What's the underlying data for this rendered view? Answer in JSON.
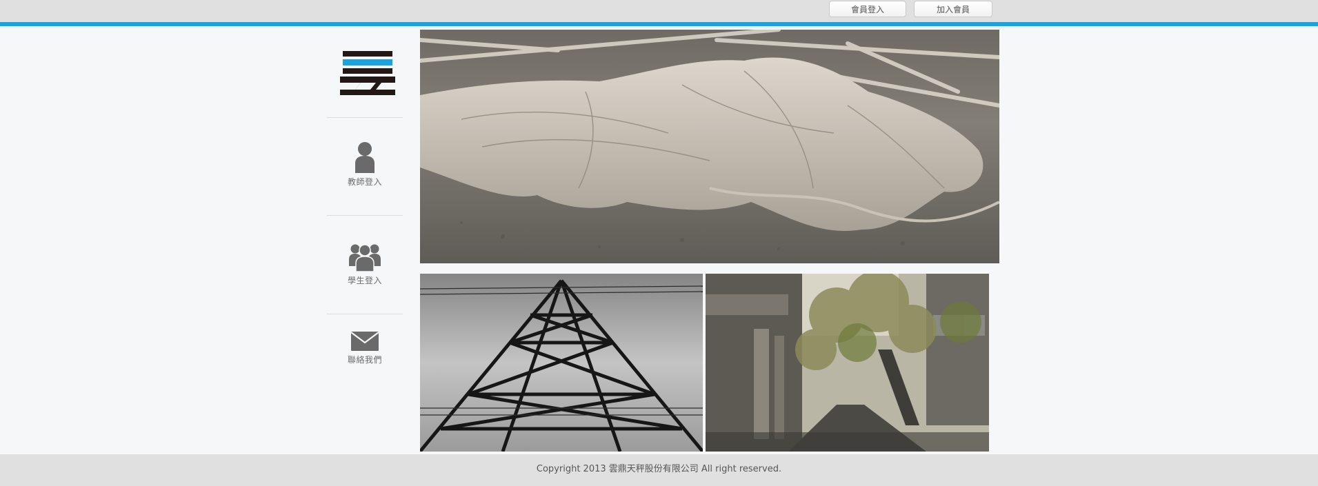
{
  "header": {
    "member_login_label": "會員登入",
    "join_member_label": "加入會員"
  },
  "colors": {
    "accent": "#1aa3df",
    "bar_gray": "#e1e0e0",
    "icon_gray": "#6a6a6a",
    "logo_dark": "#231815"
  },
  "sidebar": {
    "items": [
      {
        "label": "教師登入",
        "icon": "person-icon"
      },
      {
        "label": "學生登入",
        "icon": "group-icon"
      },
      {
        "label": "聯絡我們",
        "icon": "envelope-icon"
      }
    ]
  },
  "footer": {
    "copyright": "Copyright 2013 雲鼎天秤股份有限公司 All right reserved."
  }
}
